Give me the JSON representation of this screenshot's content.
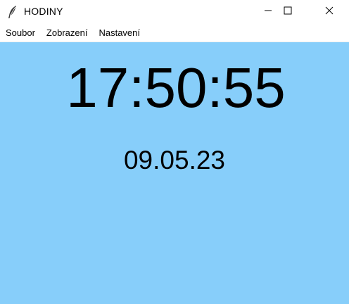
{
  "window": {
    "title": "HODINY",
    "icon": "feather-icon",
    "controls": [
      "minimize-icon",
      "maximize-icon",
      "close-icon"
    ]
  },
  "menu": {
    "items": [
      "Soubor",
      "Zobrazení",
      "Nastavení"
    ]
  },
  "clock": {
    "time": "17:50:55",
    "date": "09.05.23",
    "background": "#87cefa",
    "text_color": "#000000"
  }
}
